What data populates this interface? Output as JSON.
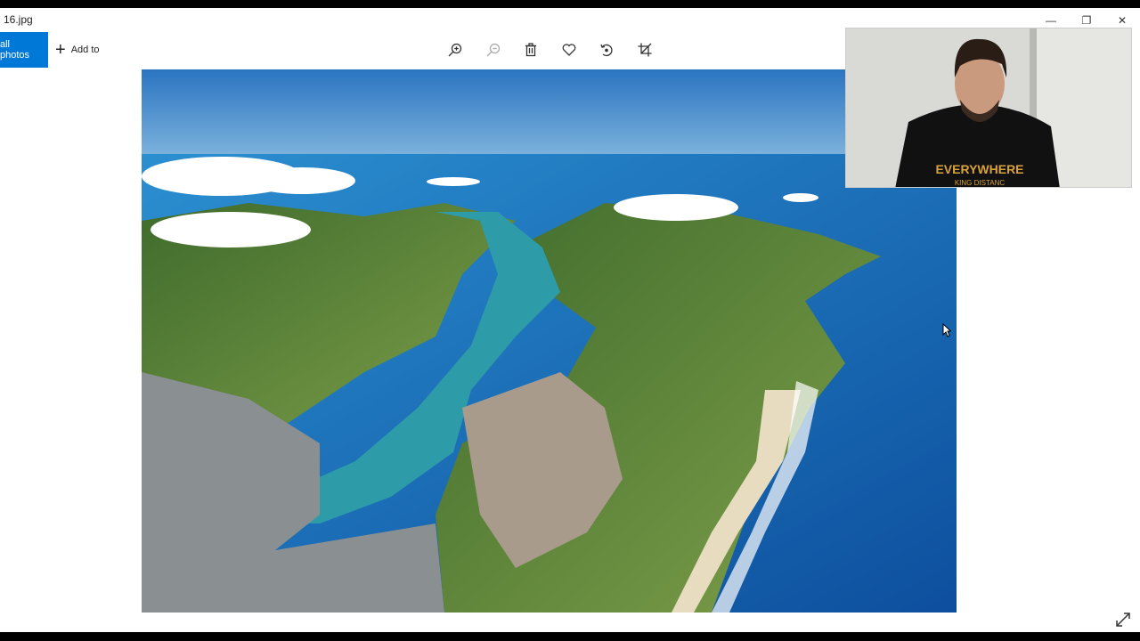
{
  "window": {
    "title": "16.jpg"
  },
  "window_controls": {
    "minimize": "—",
    "restore": "❐",
    "close": "✕"
  },
  "nav": {
    "all_photos_label": "all photos",
    "add_to_label": "Add to"
  },
  "toolbar": {
    "items": [
      {
        "icon": "zoom-in-icon"
      },
      {
        "icon": "zoom-out-icon",
        "disabled": true
      },
      {
        "icon": "delete-icon"
      },
      {
        "icon": "favorite-icon"
      },
      {
        "icon": "rotate-icon"
      },
      {
        "icon": "crop-icon"
      }
    ]
  },
  "photo": {
    "description_icon": "aerial-photo-harbor-peninsula"
  },
  "webcam": {
    "shirt_text": "EVERYWHERE",
    "shirt_subtext": "KING DISTANC"
  },
  "colors": {
    "accent": "#0078d7",
    "sky": "#3a86c8",
    "ocean": "#1f78c4",
    "harbor": "#2e9ba8",
    "land": "#5a8a3a"
  }
}
